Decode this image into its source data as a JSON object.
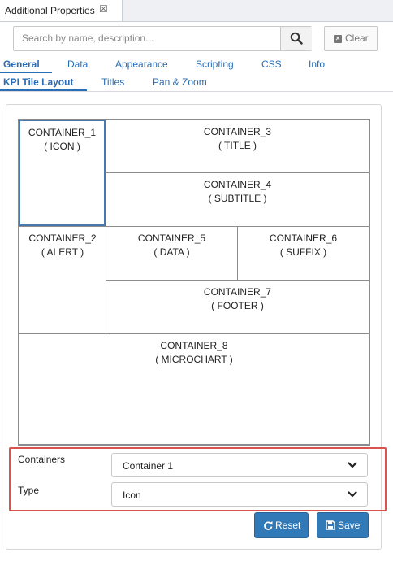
{
  "view": {
    "title": "Additional Properties",
    "close_glyph": "☒"
  },
  "search": {
    "placeholder": "Search by name, description...",
    "value": "",
    "clear_label": "Clear"
  },
  "tabs_row1": [
    "General",
    "Data",
    "Appearance",
    "Scripting",
    "CSS",
    "Info"
  ],
  "tabs_row2": [
    "KPI Tile Layout",
    "Titles",
    "Pan & Zoom"
  ],
  "active_tab1": "General",
  "active_tab2": "KPI Tile Layout",
  "layout": {
    "cells": [
      {
        "name": "CONTAINER_1",
        "role": "( ICON )",
        "selected": true
      },
      {
        "name": "CONTAINER_3",
        "role": "( TITLE )"
      },
      {
        "name": "CONTAINER_4",
        "role": "( SUBTITLE )"
      },
      {
        "name": "CONTAINER_2",
        "role": "( ALERT )"
      },
      {
        "name": "CONTAINER_5",
        "role": "( DATA )"
      },
      {
        "name": "CONTAINER_6",
        "role": "( SUFFIX )"
      },
      {
        "name": "CONTAINER_7",
        "role": "( FOOTER )"
      },
      {
        "name": "CONTAINER_8",
        "role": "( MICROCHART )"
      }
    ]
  },
  "form": {
    "containers_label": "Containers",
    "containers_value": "Container 1",
    "type_label": "Type",
    "type_value": "Icon"
  },
  "buttons": {
    "reset": "Reset",
    "save": "Save"
  },
  "colors": {
    "accent": "#2a6db5",
    "button": "#3279b7",
    "highlight_border": "#d9534f",
    "selected_cell": "#4a79ae"
  }
}
